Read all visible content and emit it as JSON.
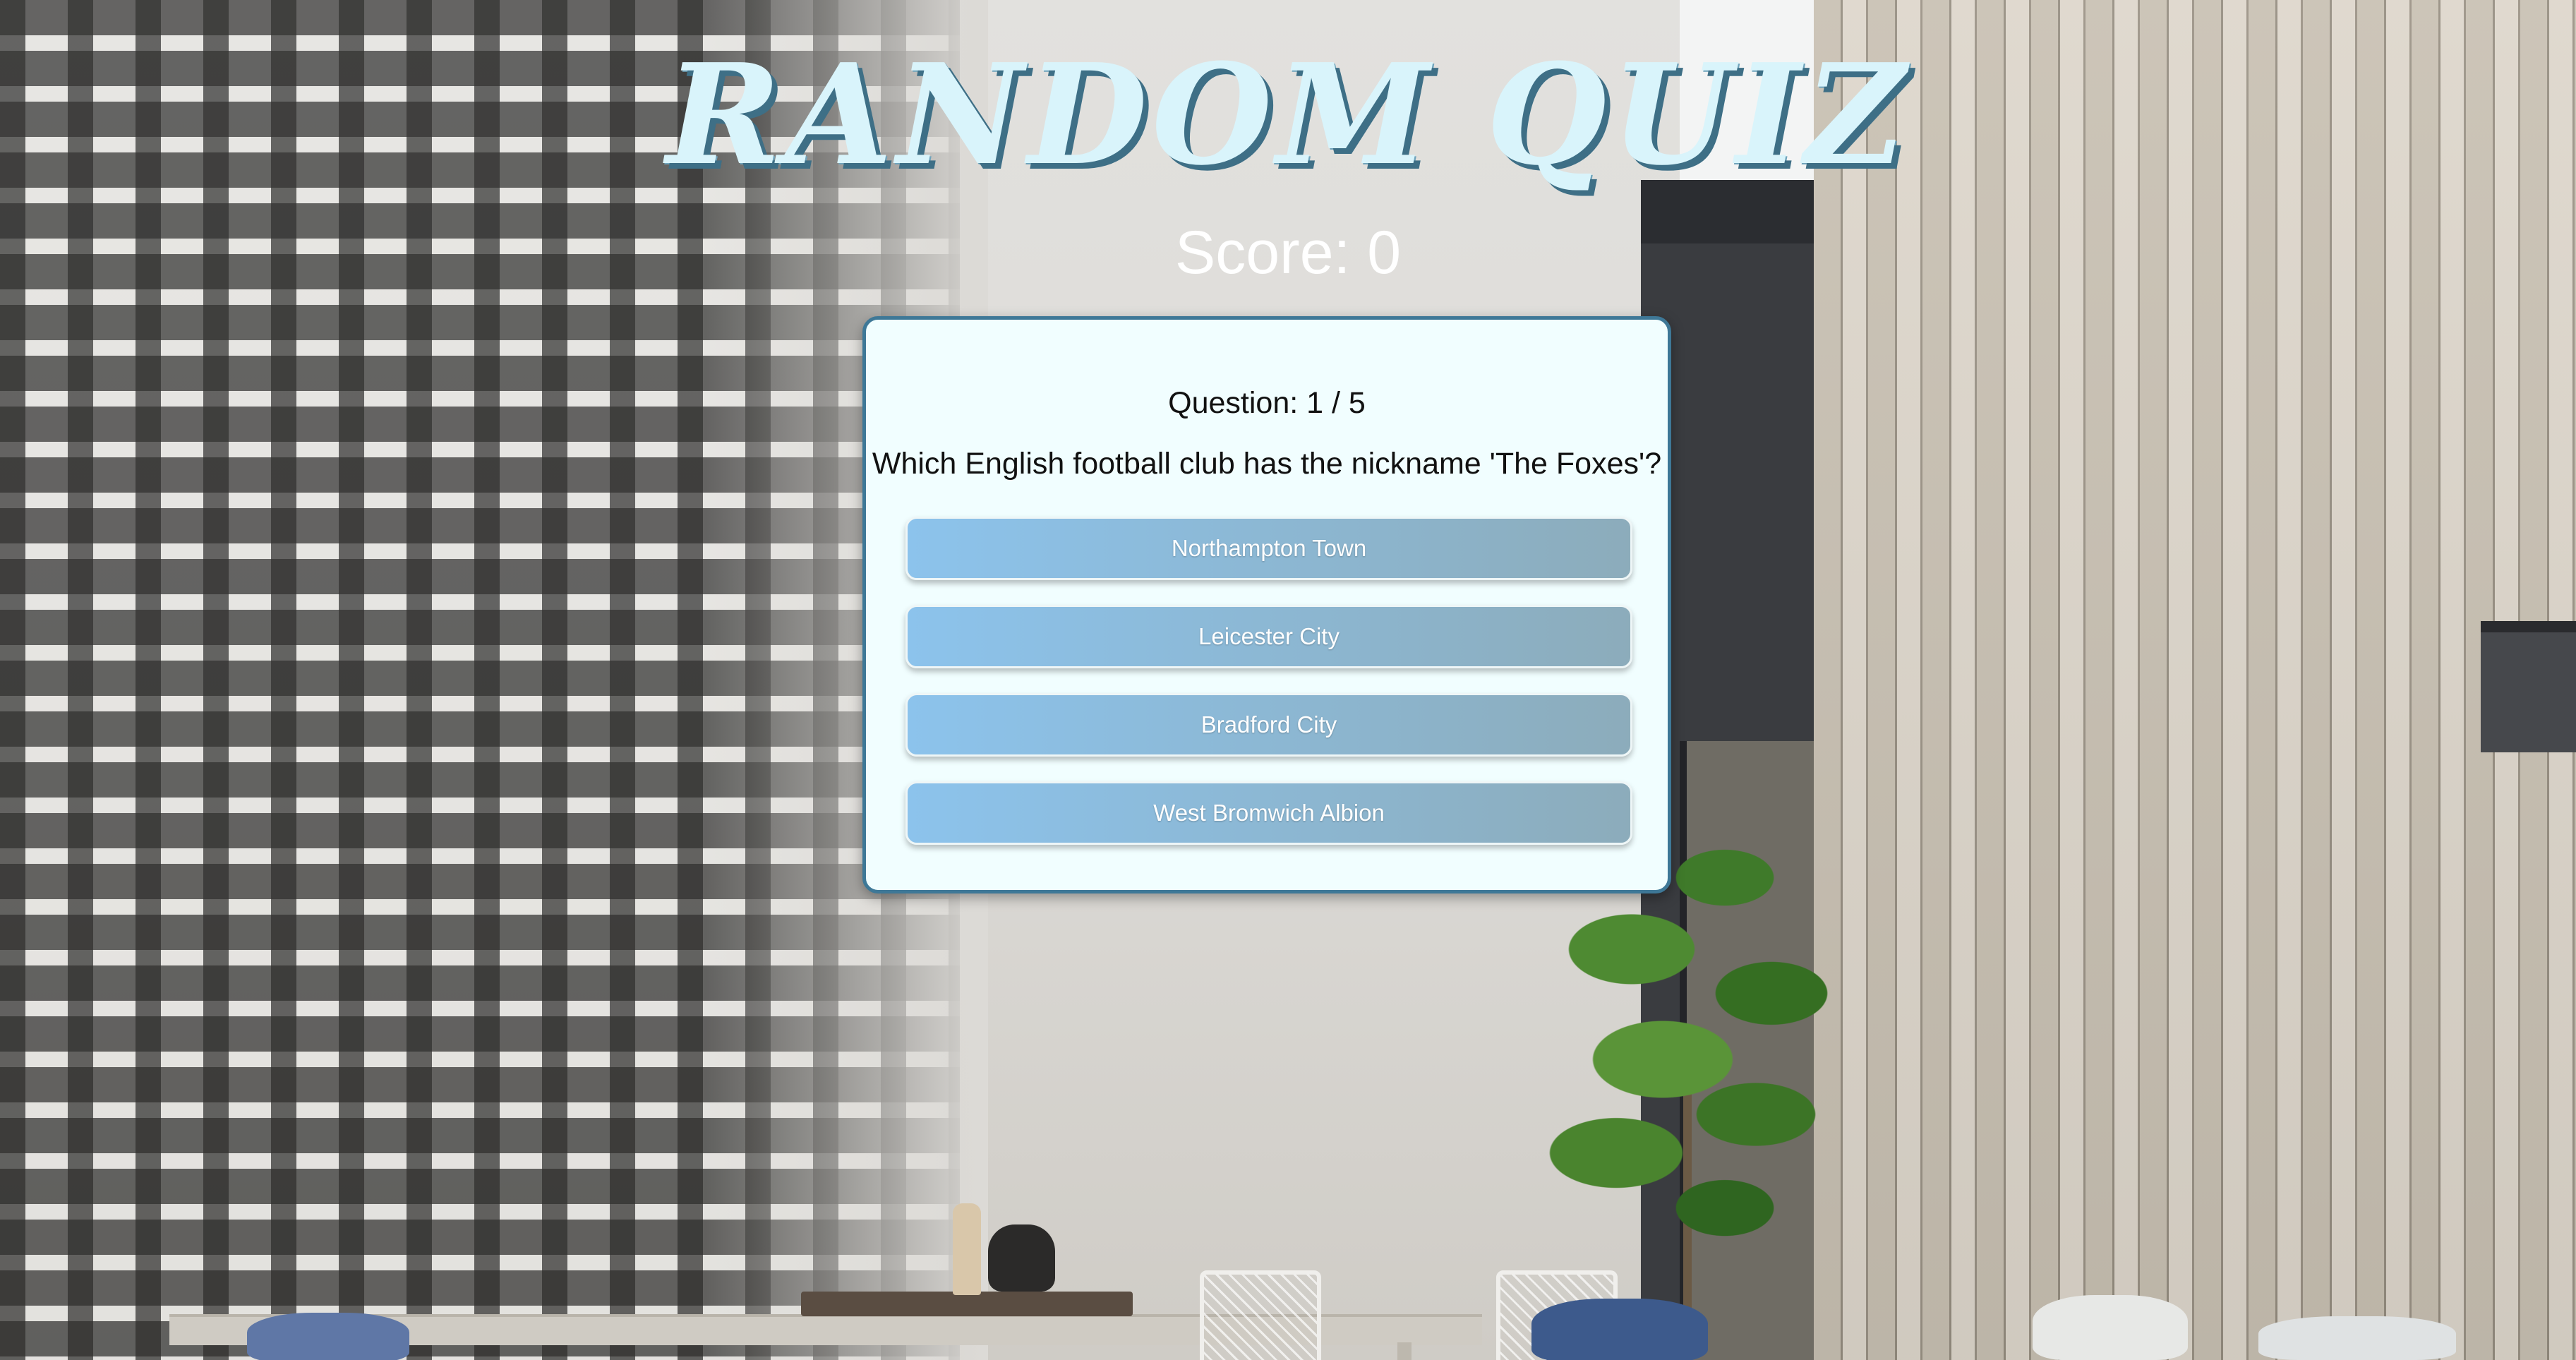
{
  "app": {
    "title": "RANDOM QUIZ",
    "score_text": "Score: 0"
  },
  "quiz": {
    "question_counter": "Question: 1 / 5",
    "question": "Which English football club has the nickname 'The Foxes'?",
    "answers": [
      {
        "label": "Northampton Town"
      },
      {
        "label": "Leicester City"
      },
      {
        "label": "Bradford City"
      },
      {
        "label": "West Bromwich Albion"
      }
    ]
  },
  "colors": {
    "title_fill": "#d9f4fb",
    "title_shadow": "#3e6f86",
    "card_background": "#f1feff",
    "card_border": "#3e7897",
    "answer_gradient_start": "#8cc3ec",
    "answer_gradient_end": "#8cacbb"
  }
}
